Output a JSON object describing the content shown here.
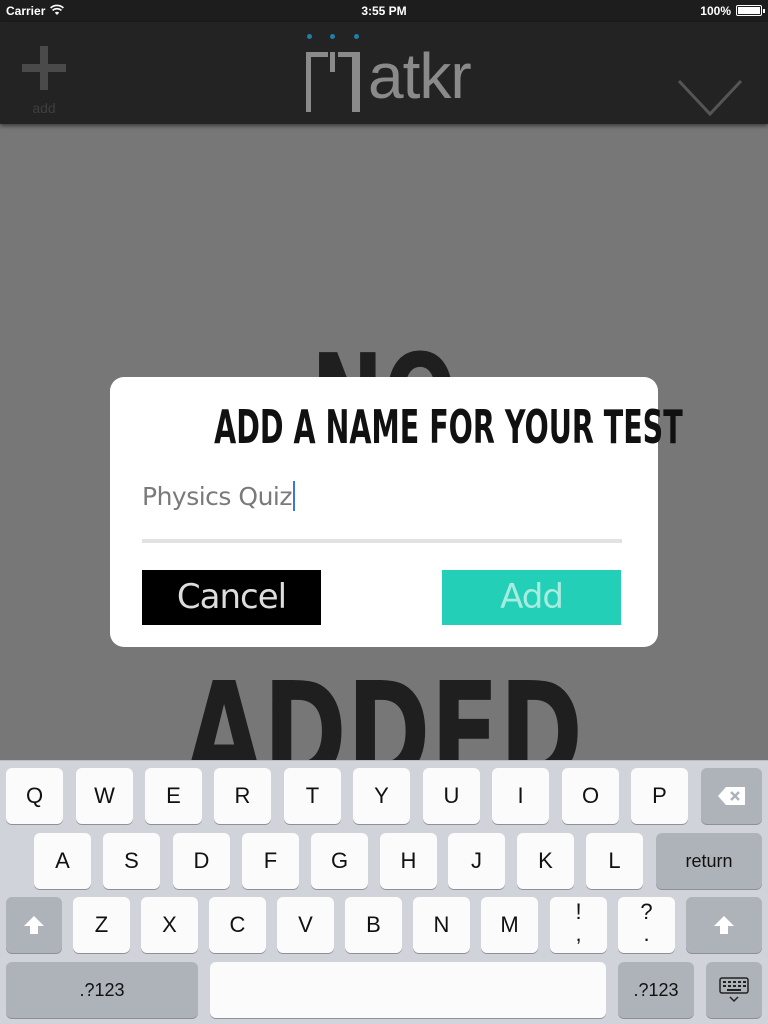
{
  "status_bar": {
    "carrier": "Carrier",
    "time": "3:55 PM",
    "battery": "100%"
  },
  "nav": {
    "add_label": "add",
    "logo_text": "atkr",
    "accent": "#1e7fa8"
  },
  "background": {
    "line1": "NO",
    "line2": "ADDED"
  },
  "dialog": {
    "title": "ADD A NAME FOR YOUR TEST",
    "input_value": "Physics Quiz",
    "cancel_label": "Cancel",
    "add_label": "Add",
    "add_color": "#23cfb6"
  },
  "keyboard": {
    "row1": [
      "Q",
      "W",
      "E",
      "R",
      "T",
      "Y",
      "U",
      "I",
      "O",
      "P"
    ],
    "row2": [
      "A",
      "S",
      "D",
      "F",
      "G",
      "H",
      "J",
      "K",
      "L"
    ],
    "row3": [
      "Z",
      "X",
      "C",
      "V",
      "B",
      "N",
      "M"
    ],
    "exclaim_top": "!",
    "exclaim_bottom": ",",
    "question_top": "?",
    "question_bottom": ".",
    "return_label": "return",
    "numbers_label": ".?123"
  }
}
